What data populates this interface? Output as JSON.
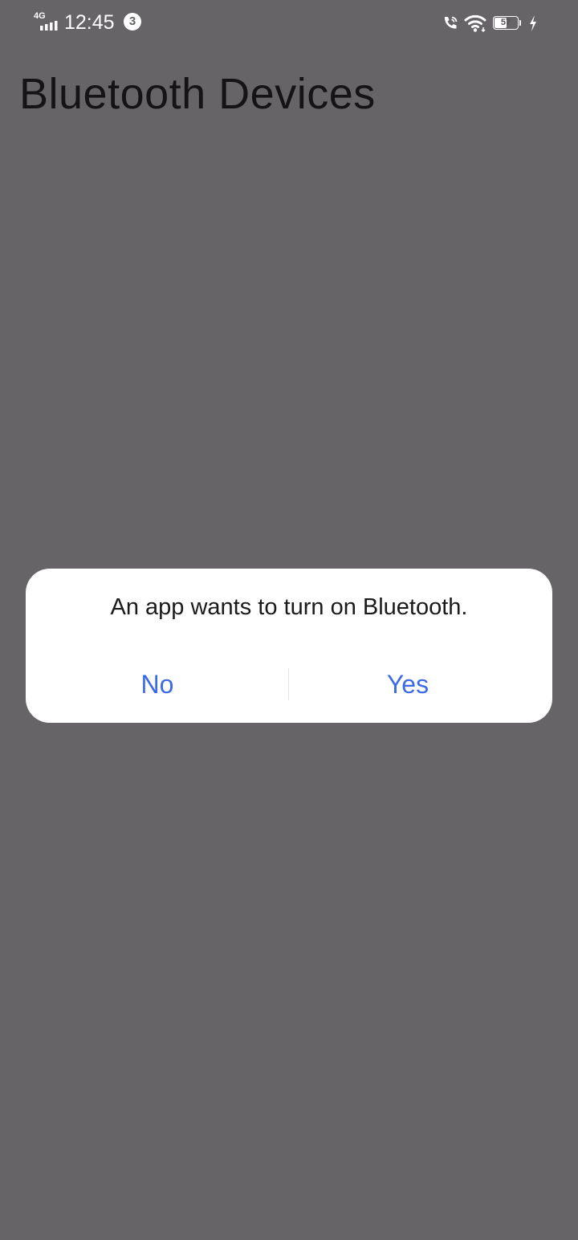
{
  "status_bar": {
    "network": "4G",
    "time": "12:45",
    "notification_count": "3",
    "battery_level": "57",
    "battery_percent": 57,
    "icons": [
      "signal-icon",
      "wifi-calling-icon",
      "wifi-icon",
      "battery-icon",
      "charging-icon"
    ]
  },
  "page": {
    "title": "Bluetooth Devices"
  },
  "dialog": {
    "message": "An app wants to turn on Bluetooth.",
    "no_label": "No",
    "yes_label": "Yes"
  },
  "colors": {
    "overlay_background": "#666467",
    "accent": "#3d6ae6",
    "dialog_background": "#ffffff"
  }
}
